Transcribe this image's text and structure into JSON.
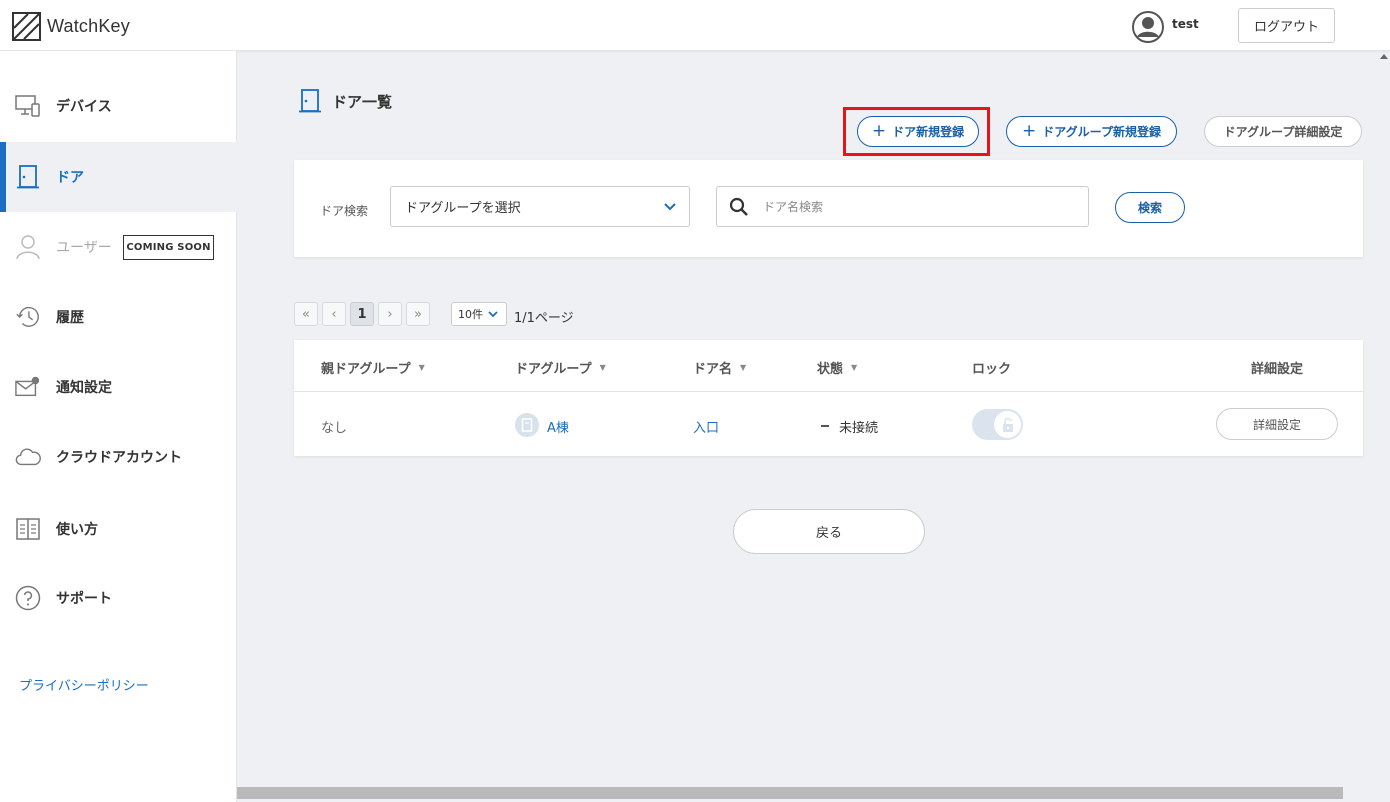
{
  "app": {
    "name": "WatchKey"
  },
  "header": {
    "user_name": "test",
    "logout_label": "ログアウト"
  },
  "sidebar": {
    "items": [
      {
        "label": "デバイス",
        "icon": "monitor-icon"
      },
      {
        "label": "ドア",
        "icon": "door-icon",
        "active": true
      },
      {
        "label": "ユーザー",
        "icon": "user-icon",
        "badge": "COMING SOON",
        "disabled": true
      },
      {
        "label": "履歴",
        "icon": "history-icon"
      },
      {
        "label": "通知設定",
        "icon": "mail-icon"
      },
      {
        "label": "クラウドアカウント",
        "icon": "cloud-icon"
      },
      {
        "label": "使い方",
        "icon": "book-icon"
      },
      {
        "label": "サポート",
        "icon": "help-icon"
      }
    ],
    "privacy_label": "プライバシーポリシー"
  },
  "main": {
    "title": "ドア一覧",
    "actions": {
      "new_door": "ドア新規登録",
      "new_group": "ドアグループ新規登録",
      "group_settings": "ドアグループ詳細設定"
    },
    "search": {
      "label": "ドア検索",
      "group_select_value": "ドアグループを選択",
      "name_placeholder": "ドア名検索",
      "button": "検索"
    },
    "pagination": {
      "first": "«",
      "prev": "‹",
      "current": "1",
      "next": "›",
      "last": "»",
      "per_page": "10件",
      "info": "1/1ページ"
    },
    "table": {
      "columns": [
        "親ドアグループ",
        "ドアグループ",
        "ドア名",
        "状態",
        "ロック",
        "詳細設定"
      ],
      "rows": [
        {
          "parent_group": "なし",
          "group": "A棟",
          "door_name": "入口",
          "status": "未接続",
          "lock": "unlocked",
          "detail_button": "詳細設定"
        }
      ]
    },
    "back_label": "戻る"
  },
  "colors": {
    "accent": "#1a6ec4",
    "highlight": "#e6141b",
    "background": "#eef0f3"
  }
}
